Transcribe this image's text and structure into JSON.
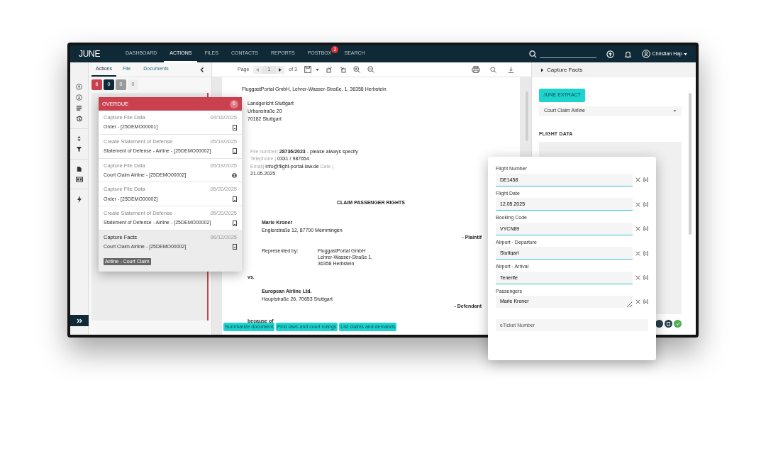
{
  "nav": {
    "logo": "JUNE",
    "items": [
      {
        "label": "DASHBOARD",
        "selected": false
      },
      {
        "label": "ACTIONS",
        "selected": true
      },
      {
        "label": "FILES",
        "selected": false
      },
      {
        "label": "CONTACTS",
        "selected": false
      },
      {
        "label": "REPORTS",
        "selected": false
      },
      {
        "label": "POSTBOX",
        "selected": false,
        "badge": "2"
      },
      {
        "label": "SEARCH",
        "selected": false
      }
    ],
    "user": "Christian Hap"
  },
  "left_panel": {
    "tabs": [
      {
        "label": "Actions",
        "selected": true
      },
      {
        "label": "File",
        "selected": false
      },
      {
        "label": "Documents",
        "selected": false
      }
    ],
    "counters": [
      {
        "value": "6",
        "color": "#c9404e"
      },
      {
        "value": "0",
        "color": "#0f2a36"
      },
      {
        "value": "0",
        "color": "#9a9a9a"
      },
      {
        "value": "0",
        "color": "#eeeeee"
      }
    ]
  },
  "overdue": {
    "title": "OVERDUE",
    "count": "6",
    "items": [
      {
        "title": "Capture File Data",
        "date": "04/16/2025",
        "subtitle": "Order  -  [25DEMO00001]",
        "kind": "document",
        "selected": false
      },
      {
        "title": "Create Statement of Defense",
        "date": "05/19/2025",
        "subtitle": "Statement of Defense - Airline  -  [25DEMO00002]",
        "kind": "document",
        "selected": false
      },
      {
        "title": "Capture File Data",
        "date": "05/19/2025",
        "subtitle": "Court Claim Airline  -  [25DEMO00002]",
        "kind": "person",
        "selected": false
      },
      {
        "title": "Capture File Data",
        "date": "05/20/2025",
        "subtitle": "Order  -  [25DEMO00002]",
        "kind": "document",
        "selected": false
      },
      {
        "title": "Create Statement of Defense",
        "date": "05/20/2025",
        "subtitle": "Statement of Defense - Airline  -  [25DEMO00002]",
        "kind": "document",
        "selected": false
      },
      {
        "title": "Capture Facts",
        "date": "06/12/2025",
        "subtitle": "Court Claim Airline  -  [25DEMO00002]",
        "tag": "Airline - Court Claim",
        "kind": "document",
        "selected": true
      }
    ]
  },
  "viewer": {
    "page_label": "Page",
    "page": "1",
    "page_count": "of 3"
  },
  "document": {
    "sender": "FluggastPortal GmbH, Lehrer-Wasser-Straße. 1, 36358 Herbstein",
    "recipient": [
      "Landgericht Stuttgart",
      "Urbanstraße 20",
      "70182 Stuttgart"
    ],
    "meta": [
      {
        "label": "File number|",
        "value": "**28736/2023** - please always specify"
      },
      {
        "label": "Telephone |",
        "value": "0331 / 987654"
      },
      {
        "label": "Email|",
        "value": "info@flight-portal-law.de",
        "after": "Date |"
      }
    ],
    "date": "21.05.2025",
    "heading": "CLAIM PASSENGER RIGHTS",
    "plaintiff_name": "Marie Kroner",
    "plaintiff_address": "Englerstraße 12, 87700 Memmingen",
    "plaintiff_role": "- Plaintif",
    "represented_label": "Represented by:",
    "representative": [
      "FluggastPortal GmbH",
      "Lehrer-Wasser-Straße 1,",
      "36358 Herbstein"
    ],
    "versus": "vs.",
    "defendant_name": "European Airline Ltd.",
    "defendant_address": "Hauptstraße 26, 70653 Stuttgart",
    "defendant_role": "- Defendant",
    "because": "because of"
  },
  "ai_actions": [
    "Summarize document",
    "Find laws and court rulings",
    "List claims and demands"
  ],
  "right_panel": {
    "title": "Capture Facts",
    "extract_button": "JUNE EXTRACT",
    "template": "Court Claim Airline",
    "section": "FLIGHT DATA"
  },
  "form": {
    "fields": [
      {
        "label": "Flight Number",
        "value": "DE1458",
        "kind": "text"
      },
      {
        "label": "Flight Date",
        "value": "12.05.2025",
        "kind": "text"
      },
      {
        "label": "Booking Code",
        "value": "VYCN89",
        "kind": "text"
      },
      {
        "label": "Airport - Departure",
        "value": "Stuttgart",
        "kind": "text"
      },
      {
        "label": "Airport - Arrival",
        "value": "Tenerife",
        "kind": "text"
      },
      {
        "label": "Passengers",
        "value": "Marie Kroner",
        "kind": "textarea"
      }
    ],
    "extra_field": {
      "placeholder": "eTicket Number"
    }
  }
}
